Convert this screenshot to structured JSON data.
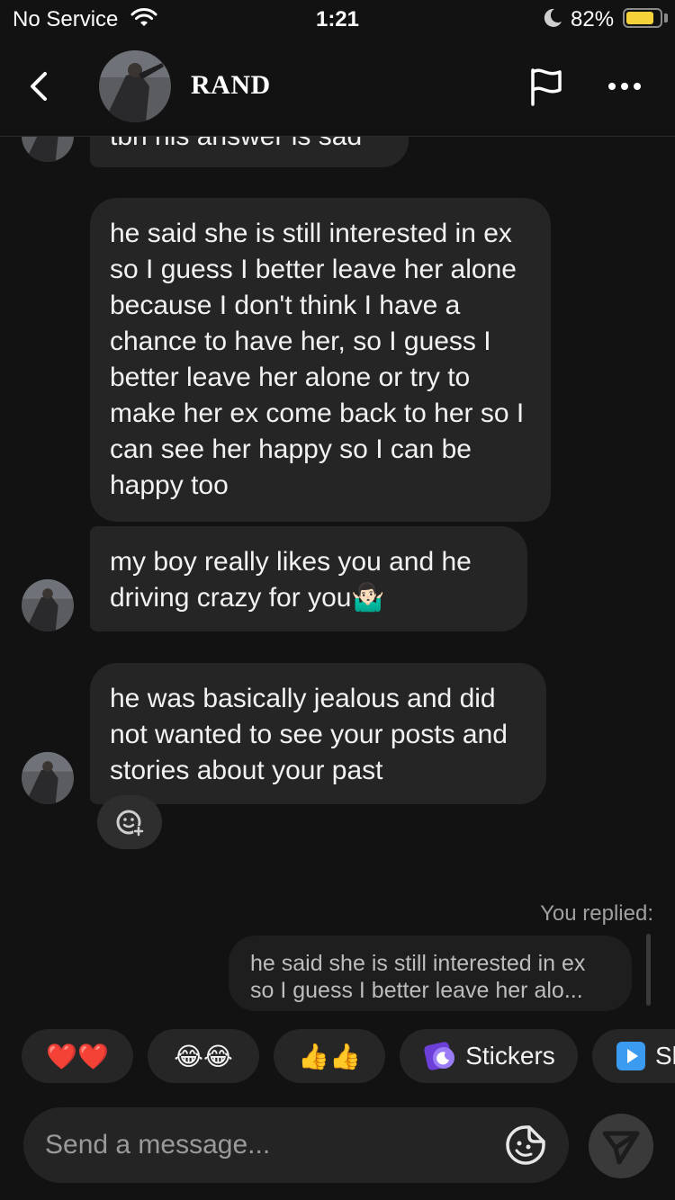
{
  "status_bar": {
    "carrier": "No Service",
    "time": "1:21",
    "battery_percent": "82%",
    "battery_level": 0.82
  },
  "header": {
    "contact_name": "RAND",
    "icons": [
      "back-icon",
      "flag-icon",
      "more-icon"
    ]
  },
  "messages": [
    {
      "text": "tbh his answer is sad",
      "sender": "contact"
    },
    {
      "text": "he said she is still interested in ex so I guess I better leave her alone because I don't think I have a chance to have her, so I guess I better leave her alone or try to make her ex come back to her so I can see her happy so I can be happy too",
      "sender": "contact"
    },
    {
      "text": "my boy really likes you and he driving crazy for you🤷🏻‍♂️",
      "sender": "contact"
    },
    {
      "text": "he was basically jealous and did not wanted to see your posts and stories about your past",
      "sender": "contact"
    }
  ],
  "reply": {
    "label": "You replied:",
    "quoted_line1": "he said she is still interested in ex",
    "quoted_line2": "so I guess I better leave her alo..."
  },
  "quick_reactions": [
    {
      "label": "❤️❤️"
    },
    {
      "label": "😂😂"
    },
    {
      "label": "👍👍"
    },
    {
      "label": "Stickers",
      "icon": "stickers-icon"
    },
    {
      "label": "Sl",
      "icon": "video-icon"
    }
  ],
  "input": {
    "placeholder": "Send a message..."
  },
  "colors": {
    "background": "#121212",
    "bubble": "#252525",
    "battery": "#f6d23a",
    "stickers_accent": "#8a5cf6",
    "video_accent": "#3b9bf0"
  }
}
